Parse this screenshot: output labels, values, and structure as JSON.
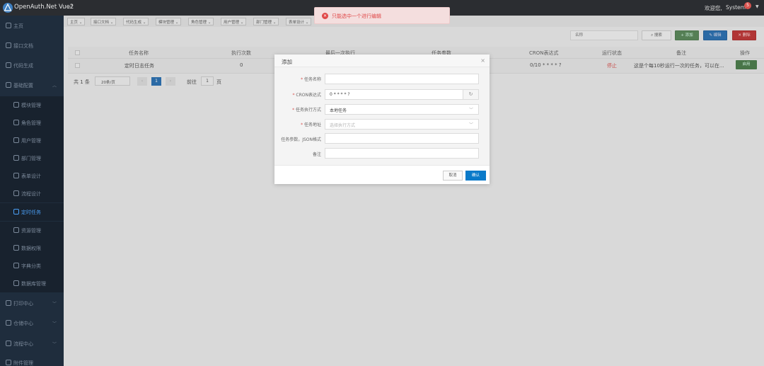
{
  "header": {
    "title": "OpenAuth.Net Vue2",
    "welcome": "欢迎您,",
    "user": "System",
    "badge": "5"
  },
  "sidebar": {
    "items": [
      {
        "label": "主页",
        "icon": "home-icon"
      },
      {
        "label": "接口文档",
        "icon": "doc-icon"
      },
      {
        "label": "代码生成",
        "icon": "code-icon"
      },
      {
        "label": "基础配置",
        "icon": "settings-icon",
        "expanded": true
      },
      {
        "label": "模块管理",
        "icon": "module-icon"
      },
      {
        "label": "角色管理",
        "icon": "role-icon"
      },
      {
        "label": "用户管理",
        "icon": "user-icon"
      },
      {
        "label": "部门管理",
        "icon": "dept-icon"
      },
      {
        "label": "表单设计",
        "icon": "form-icon"
      },
      {
        "label": "流程设计",
        "icon": "flow-icon"
      },
      {
        "label": "定时任务",
        "icon": "timer-icon",
        "active": true
      },
      {
        "label": "资源管理",
        "icon": "resource-icon"
      },
      {
        "label": "数据权限",
        "icon": "permission-icon"
      },
      {
        "label": "字典分类",
        "icon": "dictionary-icon"
      },
      {
        "label": "数据库管理",
        "icon": "database-icon"
      },
      {
        "label": "打印中心",
        "icon": "print-icon"
      },
      {
        "label": "仓储中心",
        "icon": "warehouse-icon"
      },
      {
        "label": "流程中心",
        "icon": "workflow-icon"
      },
      {
        "label": "附件管理",
        "icon": "attachment-icon"
      }
    ]
  },
  "tabs": [
    "主页",
    "接口文档",
    "代码生成",
    "模块管理",
    "角色管理",
    "用户管理",
    "部门管理",
    "表单设计"
  ],
  "toast": {
    "message": "只能选中一个进行编辑"
  },
  "toolbar": {
    "search_placeholder": "名称",
    "search_label": "搜索",
    "add_label": "+ 添加",
    "edit_label": "编辑",
    "delete_label": "删除"
  },
  "table": {
    "columns": [
      "任务名称",
      "执行次数",
      "最后一次执行",
      "任务参数",
      "CRON表达式",
      "运行状态",
      "备注",
      "操作"
    ],
    "rows": [
      {
        "name": "定时日志任务",
        "count": "0",
        "cron": "0/10 * * * * ?",
        "status": "停止",
        "remark": "这是个每10秒运行一次的任务，可以在...",
        "action": "启用"
      }
    ]
  },
  "pagination": {
    "total": "共 1 条",
    "page_size": "20条/页",
    "current": "1",
    "goto": "前往",
    "page_input": "1",
    "page_unit": "页"
  },
  "modal": {
    "title": "添加",
    "fields": [
      {
        "label": "任务名称",
        "required": true,
        "value": "",
        "placeholder": ""
      },
      {
        "label": "CRON表达式",
        "required": true,
        "value": "0 * * * * ?",
        "placeholder": ""
      },
      {
        "label": "任务执行方式",
        "required": true,
        "value": "本地任务",
        "placeholder": ""
      },
      {
        "label": "任务地址",
        "required": true,
        "value": "",
        "placeholder": "选择执行方式"
      },
      {
        "label": "任务参数，JSON格式",
        "required": false,
        "value": "",
        "placeholder": ""
      },
      {
        "label": "备注",
        "required": false,
        "value": "",
        "placeholder": ""
      }
    ],
    "cancel": "取消",
    "confirm": "确认"
  },
  "colors": {
    "sidebar_bg": "#1f2d3d",
    "active": "#4a9ff5",
    "primary": "#0a7ac9",
    "danger": "#d9534f",
    "success": "#5d8a5d"
  }
}
